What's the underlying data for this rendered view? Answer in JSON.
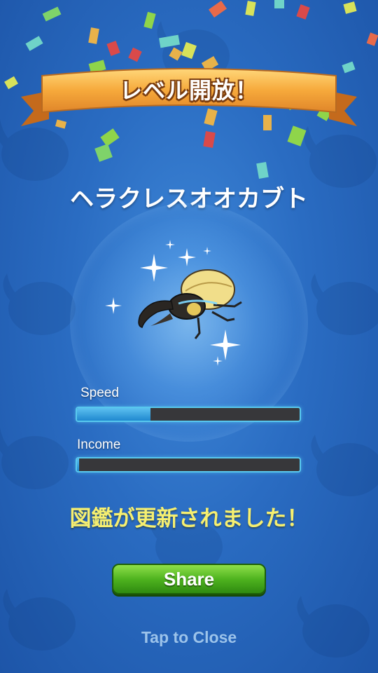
{
  "banner": {
    "title": "レベル開放！"
  },
  "species": {
    "name": "ヘラクレスオオカブト"
  },
  "stats": [
    {
      "label": "Speed",
      "level": 0.33
    },
    {
      "label": "Income",
      "level": 0.01
    }
  ],
  "message": "図鑑が更新されました！",
  "share_label": "Share",
  "close_hint": "Tap to Close",
  "colors": {
    "background": "#2a6cc2",
    "banner": "#f2a63a",
    "message": "#f6ef70",
    "share_button": "#4fb31f",
    "bar_fill": "#3aa6e4",
    "bar_track": "#37373a"
  },
  "icons": [
    "beetle-icon",
    "sparkle-icon",
    "confetti"
  ]
}
